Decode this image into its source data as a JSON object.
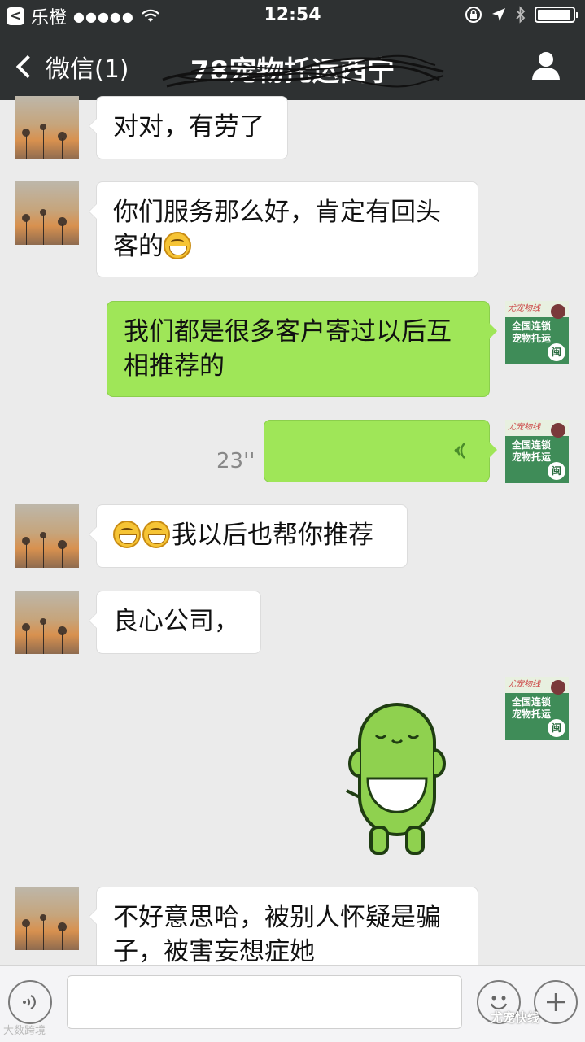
{
  "status_bar": {
    "back_app": "乐橙",
    "signal": "●●●●●",
    "time": "12:54"
  },
  "nav": {
    "back_label": "微信(1)",
    "title": "78宠物托运西宁"
  },
  "pet_avatar": {
    "brand": "尤宠物线",
    "line1": "全国连锁",
    "line2": "宠物托运",
    "stamp": "闽"
  },
  "messages": [
    {
      "side": "left",
      "text": "对对，有劳了"
    },
    {
      "side": "left",
      "text": "你们服务那么好，肯定有回头",
      "text2": "客的"
    },
    {
      "side": "right",
      "text": "我们都是很多客户寄过以后互",
      "text2": "相推荐的"
    },
    {
      "side": "right",
      "type": "voice",
      "duration": "23''"
    },
    {
      "side": "left",
      "text": "我以后也帮你推荐"
    },
    {
      "side": "left",
      "text": "良心公司，"
    },
    {
      "side": "right",
      "type": "sticker"
    },
    {
      "side": "left",
      "text": "不好意思哈，被别人怀疑是骗",
      "text2": "子，被害妄想症她"
    }
  ],
  "watermarks": {
    "left": "大数跨境",
    "right": "尤宠快线"
  },
  "colors": {
    "bar": "#2e3132",
    "bubble_sent": "#9fe658",
    "bubble_received": "#ffffff",
    "background": "#ebebeb"
  }
}
